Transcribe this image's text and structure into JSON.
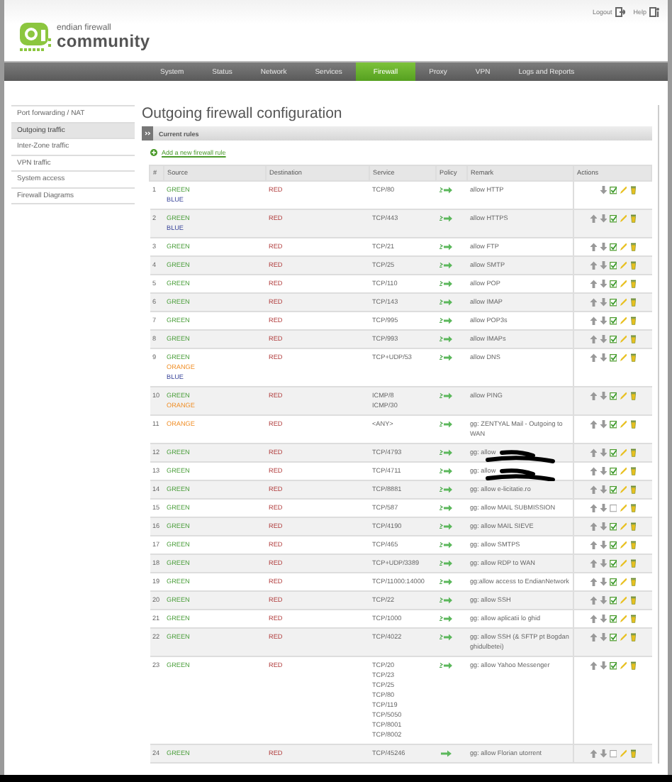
{
  "header": {
    "logo_line1": "endian firewall",
    "logo_line2": "community",
    "links": [
      {
        "label": "Logout",
        "kind": "logout"
      },
      {
        "label": "Help",
        "kind": "help"
      }
    ]
  },
  "nav": [
    {
      "label": "System",
      "selected": false
    },
    {
      "label": "Status",
      "selected": false
    },
    {
      "label": "Network",
      "selected": false
    },
    {
      "label": "Services",
      "selected": false
    },
    {
      "label": "Firewall",
      "selected": true
    },
    {
      "label": "Proxy",
      "selected": false
    },
    {
      "label": "VPN",
      "selected": false
    },
    {
      "label": "Logs and Reports",
      "selected": false
    }
  ],
  "sidebar": [
    {
      "label": "Port forwarding / NAT",
      "selected": false
    },
    {
      "label": "Outgoing traffic",
      "selected": true
    },
    {
      "label": "Inter-Zone traffic",
      "selected": false
    },
    {
      "label": "VPN traffic",
      "selected": false
    },
    {
      "label": "System access",
      "selected": false
    },
    {
      "label": "Firewall Diagrams",
      "selected": false
    }
  ],
  "title": "Outgoing firewall configuration",
  "section": {
    "title": "Current rules",
    "add_link": "Add a new firewall rule"
  },
  "table": {
    "columns": [
      "#",
      "Source",
      "Destination",
      "Service",
      "Policy",
      "Remark",
      "Actions"
    ],
    "rows": [
      {
        "num": "1",
        "source": [
          {
            "name": "GREEN",
            "kind": "green"
          },
          {
            "name": "BLUE",
            "kind": "blue"
          }
        ],
        "destination": [
          {
            "name": "RED",
            "kind": "red"
          }
        ],
        "service": [
          "TCP/80"
        ],
        "logged": true,
        "remark": "allow HTTP",
        "redacted": false,
        "enabled": true,
        "move_up": false
      },
      {
        "num": "2",
        "source": [
          {
            "name": "GREEN",
            "kind": "green"
          },
          {
            "name": "BLUE",
            "kind": "blue"
          }
        ],
        "destination": [
          {
            "name": "RED",
            "kind": "red"
          }
        ],
        "service": [
          "TCP/443"
        ],
        "logged": true,
        "remark": "allow HTTPS",
        "redacted": false,
        "enabled": true,
        "move_up": true
      },
      {
        "num": "3",
        "source": [
          {
            "name": "GREEN",
            "kind": "green"
          }
        ],
        "destination": [
          {
            "name": "RED",
            "kind": "red"
          }
        ],
        "service": [
          "TCP/21"
        ],
        "logged": true,
        "remark": "allow FTP",
        "redacted": false,
        "enabled": true,
        "move_up": true
      },
      {
        "num": "4",
        "source": [
          {
            "name": "GREEN",
            "kind": "green"
          }
        ],
        "destination": [
          {
            "name": "RED",
            "kind": "red"
          }
        ],
        "service": [
          "TCP/25"
        ],
        "logged": true,
        "remark": "allow SMTP",
        "redacted": false,
        "enabled": true,
        "move_up": true
      },
      {
        "num": "5",
        "source": [
          {
            "name": "GREEN",
            "kind": "green"
          }
        ],
        "destination": [
          {
            "name": "RED",
            "kind": "red"
          }
        ],
        "service": [
          "TCP/110"
        ],
        "logged": true,
        "remark": "allow POP",
        "redacted": false,
        "enabled": true,
        "move_up": true
      },
      {
        "num": "6",
        "source": [
          {
            "name": "GREEN",
            "kind": "green"
          }
        ],
        "destination": [
          {
            "name": "RED",
            "kind": "red"
          }
        ],
        "service": [
          "TCP/143"
        ],
        "logged": true,
        "remark": "allow IMAP",
        "redacted": false,
        "enabled": true,
        "move_up": true
      },
      {
        "num": "7",
        "source": [
          {
            "name": "GREEN",
            "kind": "green"
          }
        ],
        "destination": [
          {
            "name": "RED",
            "kind": "red"
          }
        ],
        "service": [
          "TCP/995"
        ],
        "logged": true,
        "remark": "allow POP3s",
        "redacted": false,
        "enabled": true,
        "move_up": true
      },
      {
        "num": "8",
        "source": [
          {
            "name": "GREEN",
            "kind": "green"
          }
        ],
        "destination": [
          {
            "name": "RED",
            "kind": "red"
          }
        ],
        "service": [
          "TCP/993"
        ],
        "logged": true,
        "remark": "allow IMAPs",
        "redacted": false,
        "enabled": true,
        "move_up": true
      },
      {
        "num": "9",
        "source": [
          {
            "name": "GREEN",
            "kind": "green"
          },
          {
            "name": "ORANGE",
            "kind": "orange"
          },
          {
            "name": "BLUE",
            "kind": "blue"
          }
        ],
        "destination": [
          {
            "name": "RED",
            "kind": "red"
          }
        ],
        "service": [
          "TCP+UDP/53"
        ],
        "logged": true,
        "remark": "allow DNS",
        "redacted": false,
        "enabled": true,
        "move_up": true
      },
      {
        "num": "10",
        "source": [
          {
            "name": "GREEN",
            "kind": "green"
          },
          {
            "name": "ORANGE",
            "kind": "orange"
          }
        ],
        "destination": [
          {
            "name": "RED",
            "kind": "red"
          }
        ],
        "service": [
          "ICMP/8",
          "ICMP/30"
        ],
        "logged": true,
        "remark": "allow PING",
        "redacted": false,
        "enabled": true,
        "move_up": true
      },
      {
        "num": "11",
        "source": [
          {
            "name": "ORANGE",
            "kind": "orange"
          }
        ],
        "destination": [
          {
            "name": "RED",
            "kind": "red"
          }
        ],
        "service": [
          "<ANY>"
        ],
        "logged": true,
        "remark": "gg: ZENTYAL Mail - Outgoing to WAN",
        "redacted": false,
        "enabled": true,
        "move_up": true
      },
      {
        "num": "12",
        "source": [
          {
            "name": "GREEN",
            "kind": "green"
          }
        ],
        "destination": [
          {
            "name": "RED",
            "kind": "red"
          }
        ],
        "service": [
          "TCP/4793"
        ],
        "logged": true,
        "remark": "gg: allow",
        "redacted": true,
        "enabled": true,
        "move_up": true
      },
      {
        "num": "13",
        "source": [
          {
            "name": "GREEN",
            "kind": "green"
          }
        ],
        "destination": [
          {
            "name": "RED",
            "kind": "red"
          }
        ],
        "service": [
          "TCP/4711"
        ],
        "logged": true,
        "remark": "gg: allow",
        "redacted": true,
        "enabled": true,
        "move_up": true
      },
      {
        "num": "14",
        "source": [
          {
            "name": "GREEN",
            "kind": "green"
          }
        ],
        "destination": [
          {
            "name": "RED",
            "kind": "red"
          }
        ],
        "service": [
          "TCP/8881"
        ],
        "logged": true,
        "remark": "gg: allow e-licitatie.ro",
        "redacted": false,
        "enabled": true,
        "move_up": true
      },
      {
        "num": "15",
        "source": [
          {
            "name": "GREEN",
            "kind": "green"
          }
        ],
        "destination": [
          {
            "name": "RED",
            "kind": "red"
          }
        ],
        "service": [
          "TCP/587"
        ],
        "logged": true,
        "remark": "gg: allow MAIL SUBMISSION",
        "redacted": false,
        "enabled": false,
        "move_up": true
      },
      {
        "num": "16",
        "source": [
          {
            "name": "GREEN",
            "kind": "green"
          }
        ],
        "destination": [
          {
            "name": "RED",
            "kind": "red"
          }
        ],
        "service": [
          "TCP/4190"
        ],
        "logged": true,
        "remark": "gg: allow MAIL SIEVE",
        "redacted": false,
        "enabled": true,
        "move_up": true
      },
      {
        "num": "17",
        "source": [
          {
            "name": "GREEN",
            "kind": "green"
          }
        ],
        "destination": [
          {
            "name": "RED",
            "kind": "red"
          }
        ],
        "service": [
          "TCP/465"
        ],
        "logged": true,
        "remark": "gg: allow SMTPS",
        "redacted": false,
        "enabled": true,
        "move_up": true
      },
      {
        "num": "18",
        "source": [
          {
            "name": "GREEN",
            "kind": "green"
          }
        ],
        "destination": [
          {
            "name": "RED",
            "kind": "red"
          }
        ],
        "service": [
          "TCP+UDP/3389"
        ],
        "logged": true,
        "remark": "gg: allow RDP to WAN",
        "redacted": false,
        "enabled": true,
        "move_up": true
      },
      {
        "num": "19",
        "source": [
          {
            "name": "GREEN",
            "kind": "green"
          }
        ],
        "destination": [
          {
            "name": "RED",
            "kind": "red"
          }
        ],
        "service": [
          "TCP/11000:14000"
        ],
        "logged": true,
        "remark": "gg:allow access to EndianNetwork",
        "redacted": false,
        "enabled": true,
        "move_up": true
      },
      {
        "num": "20",
        "source": [
          {
            "name": "GREEN",
            "kind": "green"
          }
        ],
        "destination": [
          {
            "name": "RED",
            "kind": "red"
          }
        ],
        "service": [
          "TCP/22"
        ],
        "logged": true,
        "remark": "gg: allow SSH",
        "redacted": false,
        "enabled": true,
        "move_up": true
      },
      {
        "num": "21",
        "source": [
          {
            "name": "GREEN",
            "kind": "green"
          }
        ],
        "destination": [
          {
            "name": "RED",
            "kind": "red"
          }
        ],
        "service": [
          "TCP/1000"
        ],
        "logged": true,
        "remark": "gg: allow aplicatii lo ghid",
        "redacted": false,
        "enabled": true,
        "move_up": true
      },
      {
        "num": "22",
        "source": [
          {
            "name": "GREEN",
            "kind": "green"
          }
        ],
        "destination": [
          {
            "name": "RED",
            "kind": "red"
          }
        ],
        "service": [
          "TCP/4022"
        ],
        "logged": true,
        "remark": "gg: allow SSH (& SFTP pt Bogdan ghidulbetei)",
        "redacted": false,
        "enabled": true,
        "move_up": true
      },
      {
        "num": "23",
        "source": [
          {
            "name": "GREEN",
            "kind": "green"
          }
        ],
        "destination": [
          {
            "name": "RED",
            "kind": "red"
          }
        ],
        "service": [
          "TCP/20",
          "TCP/23",
          "TCP/25",
          "TCP/80",
          "TCP/119",
          "TCP/5050",
          "TCP/8001",
          "TCP/8002"
        ],
        "logged": true,
        "remark": "gg: allow Yahoo Messenger",
        "redacted": false,
        "enabled": true,
        "move_up": true
      },
      {
        "num": "24",
        "source": [
          {
            "name": "GREEN",
            "kind": "green"
          }
        ],
        "destination": [
          {
            "name": "RED",
            "kind": "red"
          }
        ],
        "service": [
          "TCP/45246"
        ],
        "logged": false,
        "remark": "gg: allow Florian utorrent",
        "redacted": false,
        "enabled": false,
        "move_up": true
      }
    ]
  }
}
